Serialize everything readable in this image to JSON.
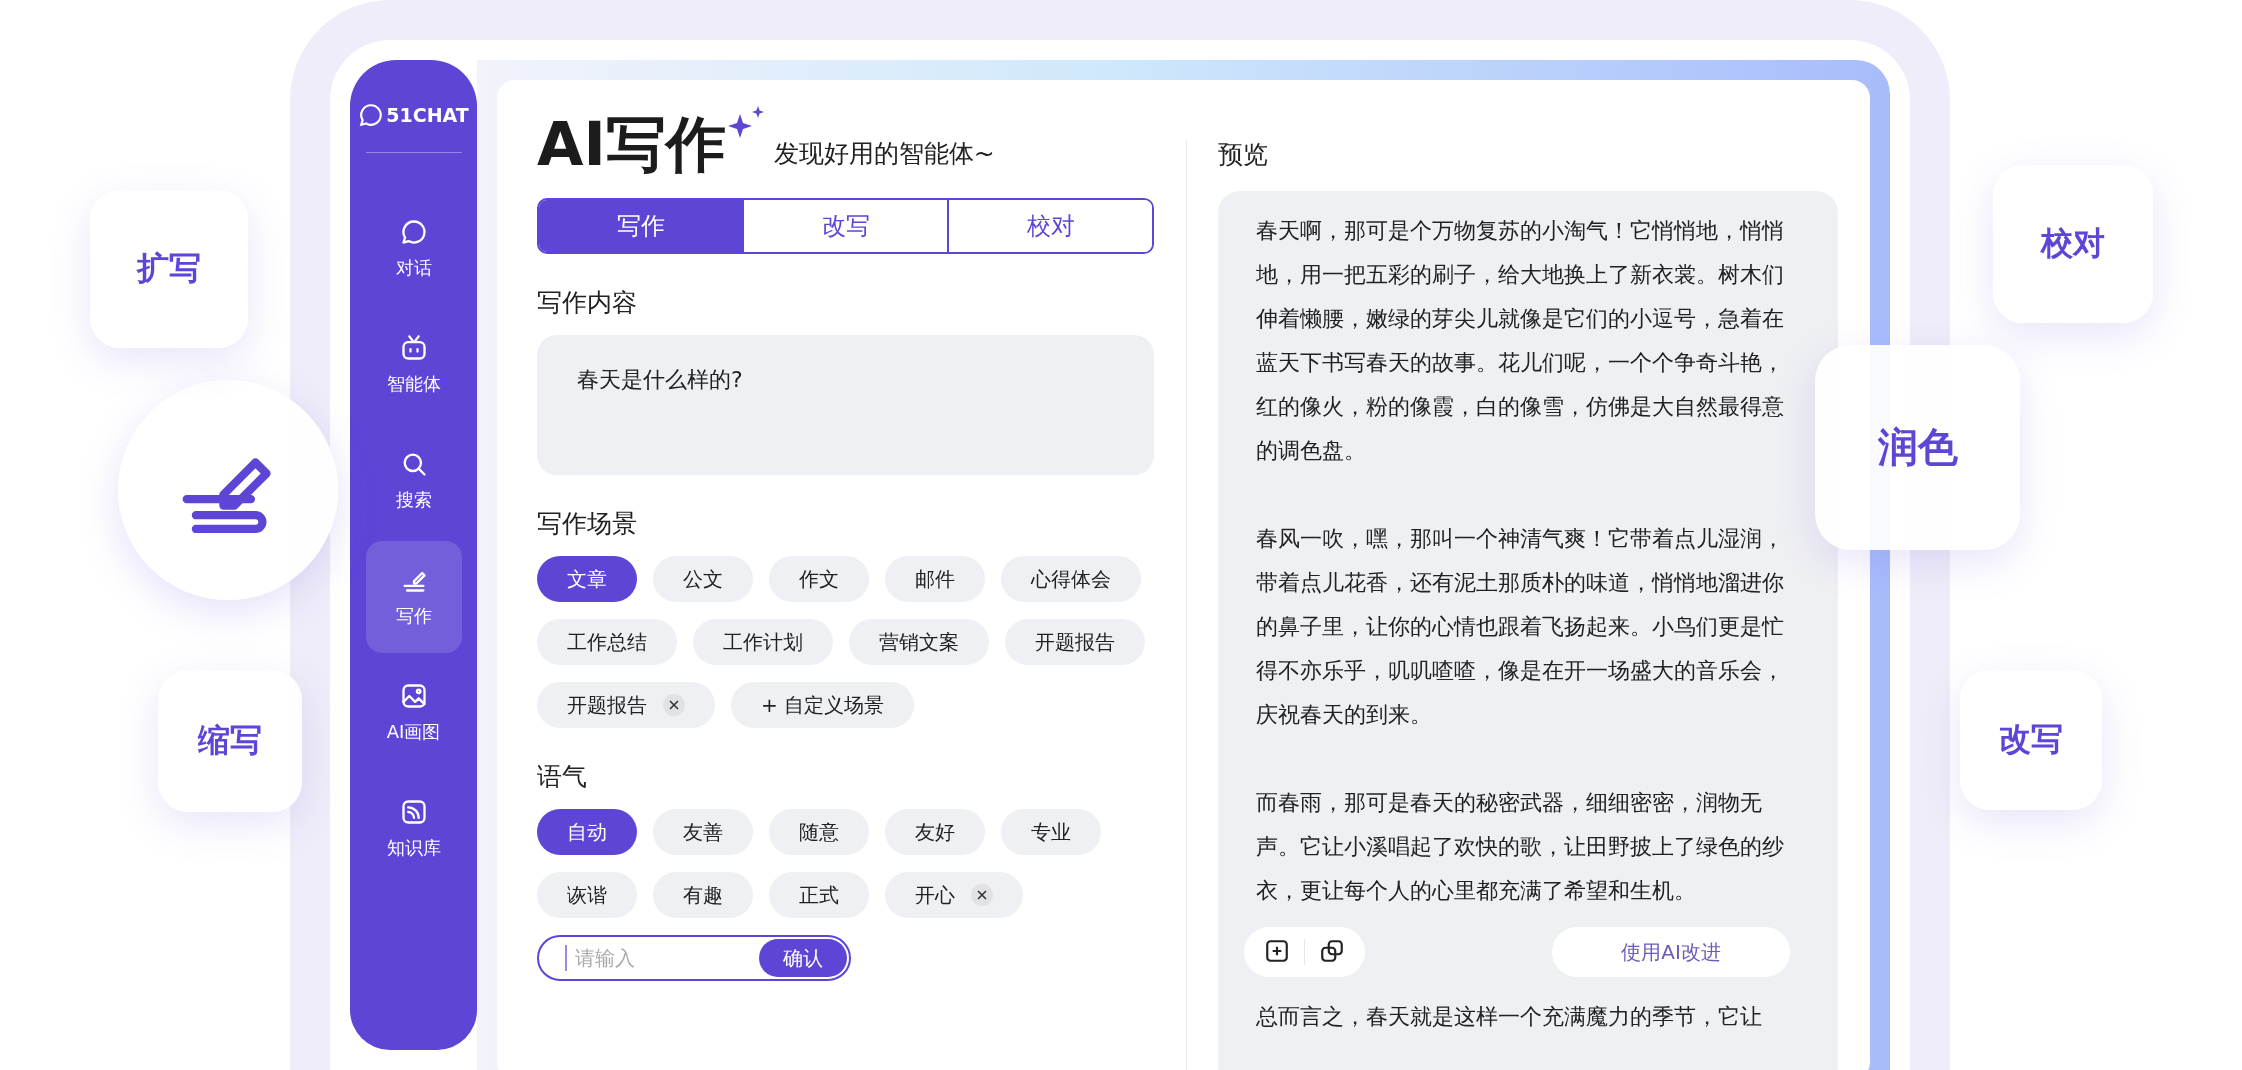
{
  "sidebar": {
    "logo": "51CHAT",
    "items": [
      {
        "label": "对话",
        "selected": false
      },
      {
        "label": "智能体",
        "selected": false
      },
      {
        "label": "搜索",
        "selected": false
      },
      {
        "label": "写作",
        "selected": true
      },
      {
        "label": "AI画图",
        "selected": false
      },
      {
        "label": "知识库",
        "selected": false
      }
    ]
  },
  "header": {
    "title": "AI写作",
    "subtitle": "发现好用的智能体~"
  },
  "tabs": [
    {
      "label": "写作",
      "selected": true
    },
    {
      "label": "改写",
      "selected": false
    },
    {
      "label": "校对",
      "selected": false
    }
  ],
  "content": {
    "label": "写作内容",
    "value": "春天是什么样的?"
  },
  "scenes": {
    "label": "写作场景",
    "chips": [
      {
        "label": "文章",
        "selected": true,
        "removable": false
      },
      {
        "label": "公文",
        "selected": false,
        "removable": false
      },
      {
        "label": "作文",
        "selected": false,
        "removable": false
      },
      {
        "label": "邮件",
        "selected": false,
        "removable": false
      },
      {
        "label": "心得体会",
        "selected": false,
        "removable": false
      },
      {
        "label": "工作总结",
        "selected": false,
        "removable": false
      },
      {
        "label": "工作计划",
        "selected": false,
        "removable": false
      },
      {
        "label": "营销文案",
        "selected": false,
        "removable": false
      },
      {
        "label": "开题报告",
        "selected": false,
        "removable": false
      },
      {
        "label": "开题报告",
        "selected": false,
        "removable": true
      }
    ],
    "add": "+ 自定义场景"
  },
  "tone": {
    "label": "语气",
    "chips": [
      {
        "label": "自动",
        "selected": true,
        "removable": false
      },
      {
        "label": "友善",
        "selected": false,
        "removable": false
      },
      {
        "label": "随意",
        "selected": false,
        "removable": false
      },
      {
        "label": "友好",
        "selected": false,
        "removable": false
      },
      {
        "label": "专业",
        "selected": false,
        "removable": false
      },
      {
        "label": "诙谐",
        "selected": false,
        "removable": false
      },
      {
        "label": "有趣",
        "selected": false,
        "removable": false
      },
      {
        "label": "正式",
        "selected": false,
        "removable": false
      },
      {
        "label": "开心",
        "selected": false,
        "removable": true
      }
    ],
    "input": {
      "placeholder": "请输入",
      "button": "确认"
    }
  },
  "preview": {
    "title": "预览",
    "paragraphs": [
      "春天啊，那可是个万物复苏的小淘气！它悄悄地，悄悄地，用一把五彩的刷子，给大地换上了新衣裳。树木们伸着懒腰，嫩绿的芽尖儿就像是它们的小逗号，急着在蓝天下书写春天的故事。花儿们呢，一个个争奇斗艳，红的像火，粉的像霞，白的像雪，仿佛是大自然最得意的调色盘。",
      "春风一吹，嘿，那叫一个神清气爽！它带着点儿湿润，带着点儿花香，还有泥土那质朴的味道，悄悄地溜进你的鼻子里，让你的心情也跟着飞扬起来。小鸟们更是忙得不亦乐乎，叽叽喳喳，像是在开一场盛大的音乐会，庆祝春天的到来。",
      "而春雨，那可是春天的秘密武器，细细密密，润物无声。它让小溪唱起了欢快的歌，让田野披上了绿色的纱衣，更让每个人的心里都充满了希望和生机。",
      "总而言之，春天就是这样一个充满魔力的季节，它让"
    ],
    "action": "使用AI改进"
  },
  "badges": [
    {
      "label": "扩写"
    },
    {
      "label": "缩写"
    },
    {
      "label": "校对"
    },
    {
      "label": "润色"
    },
    {
      "label": "改写"
    }
  ]
}
